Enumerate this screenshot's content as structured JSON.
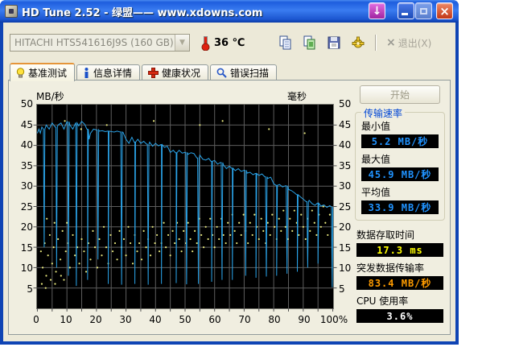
{
  "window": {
    "title": "HD Tune 2.52 - 绿盟—— www.xdowns.com"
  },
  "toolbar": {
    "drive_selected": "HITACHI HTS541616J9S (160 GB)",
    "temperature": "36 ℃",
    "exit_label": "退出(X)"
  },
  "tabs": [
    {
      "label": "基准测试",
      "icon": "lightbulb-icon",
      "active": true
    },
    {
      "label": "信息详情",
      "icon": "info-icon",
      "active": false
    },
    {
      "label": "健康状况",
      "icon": "health-cross-icon",
      "active": false
    },
    {
      "label": "错误扫描",
      "icon": "magnifier-icon",
      "active": false
    }
  ],
  "benchmark": {
    "start_label": "开始",
    "stats": {
      "group_title": "传输速率",
      "min": {
        "label": "最小值",
        "value": "5.2 MB/秒",
        "value_color": "#2093ff"
      },
      "max": {
        "label": "最大值",
        "value": "45.9 MB/秒",
        "value_color": "#2093ff"
      },
      "avg": {
        "label": "平均值",
        "value": "33.9 MB/秒",
        "value_color": "#2093ff"
      },
      "access": {
        "label": "数据存取时间",
        "value": "17.3 ms",
        "value_color": "#ffff00"
      },
      "burst": {
        "label": "突发数据传输率",
        "value": "83.4 MB/秒",
        "value_color": "#ff9c00"
      },
      "cpu": {
        "label": "CPU 使用率",
        "value": "3.6%",
        "value_color": "#ffffff"
      }
    }
  },
  "chart_data": {
    "type": "line+scatter",
    "background": "#000000",
    "grid_color": "#5e5e5e",
    "grid": true,
    "left_axis": {
      "label": "MB/秒",
      "min": 0,
      "max": 50,
      "tick_step": 5
    },
    "right_axis": {
      "label": "毫秒",
      "min": 0,
      "max": 50,
      "tick_step": 5
    },
    "x_axis": {
      "min": 0,
      "max": 100,
      "grid_step": 5,
      "labels": [
        "0",
        "10",
        "20",
        "30",
        "40",
        "50",
        "60",
        "70",
        "80",
        "90",
        "100%"
      ]
    },
    "series": [
      {
        "name": "传输速率",
        "type": "line",
        "color": "#2aa3e8",
        "base_points": [
          [
            0,
            43
          ],
          [
            0.5,
            44
          ],
          [
            1,
            43
          ],
          [
            1.5,
            44.5
          ],
          [
            2,
            44
          ],
          [
            3,
            45
          ],
          [
            4,
            44
          ],
          [
            5,
            45.5
          ],
          [
            6,
            44.5
          ],
          [
            7,
            45
          ],
          [
            8,
            45.5
          ],
          [
            9,
            44
          ],
          [
            10,
            45.8
          ],
          [
            11,
            45
          ],
          [
            12,
            44
          ],
          [
            13,
            45.5
          ],
          [
            14,
            44.8
          ],
          [
            15,
            45.9
          ],
          [
            16,
            45.2
          ],
          [
            17,
            44
          ],
          [
            17.5,
            41.5
          ],
          [
            18,
            43
          ],
          [
            19,
            44
          ],
          [
            20,
            43.8
          ],
          [
            21,
            43.5
          ],
          [
            22,
            43.6
          ],
          [
            23,
            43.4
          ],
          [
            24,
            43.5
          ],
          [
            25,
            43.4
          ],
          [
            26,
            43.3
          ],
          [
            27,
            43.5
          ],
          [
            28,
            43.3
          ],
          [
            29,
            43.2
          ],
          [
            30,
            41.5
          ],
          [
            31,
            40.5
          ],
          [
            32,
            42
          ],
          [
            33,
            40.8
          ],
          [
            34,
            41.5
          ],
          [
            35,
            40.5
          ],
          [
            36,
            41
          ],
          [
            37,
            40.3
          ],
          [
            38,
            40.8
          ],
          [
            39,
            39.8
          ],
          [
            40,
            40.5
          ],
          [
            41,
            39.9
          ],
          [
            42,
            40.2
          ],
          [
            43,
            39.5
          ],
          [
            44,
            39.8
          ],
          [
            45,
            38.3
          ],
          [
            46,
            38.8
          ],
          [
            47,
            38.2
          ],
          [
            48,
            38.8
          ],
          [
            49,
            38.1
          ],
          [
            50,
            38.3
          ],
          [
            51,
            37.8
          ],
          [
            52,
            38.2
          ],
          [
            53,
            38
          ],
          [
            54,
            36.9
          ],
          [
            55,
            37.6
          ],
          [
            56,
            36.6
          ],
          [
            57,
            36.4
          ],
          [
            58,
            36.8
          ],
          [
            59,
            36.1
          ],
          [
            60,
            36.3
          ],
          [
            61,
            35.4
          ],
          [
            62,
            35.8
          ],
          [
            63,
            35.2
          ],
          [
            64,
            34.3
          ],
          [
            65,
            34.9
          ],
          [
            66,
            34.4
          ],
          [
            67,
            33.8
          ],
          [
            68,
            34.3
          ],
          [
            69,
            33.6
          ],
          [
            70,
            33.9
          ],
          [
            71,
            33.2
          ],
          [
            72,
            33.4
          ],
          [
            73,
            32.8
          ],
          [
            74,
            33.1
          ],
          [
            75,
            32.6
          ],
          [
            76,
            33
          ],
          [
            77,
            32.3
          ],
          [
            78,
            31.9
          ],
          [
            79,
            32.2
          ],
          [
            80,
            30.6
          ],
          [
            81,
            30.2
          ],
          [
            82,
            30.4
          ],
          [
            83,
            29.8
          ],
          [
            84,
            30.1
          ],
          [
            85,
            29.2
          ],
          [
            86,
            28.9
          ],
          [
            87,
            28.4
          ],
          [
            88,
            27.9
          ],
          [
            89,
            27.4
          ],
          [
            90,
            26.8
          ],
          [
            91,
            26.2
          ],
          [
            92,
            26.5
          ],
          [
            93,
            25.7
          ],
          [
            94,
            25.3
          ],
          [
            95,
            25.8
          ],
          [
            96,
            25.1
          ],
          [
            97,
            25.4
          ],
          [
            98,
            24.8
          ],
          [
            99,
            25.2
          ],
          [
            100,
            24.9
          ]
        ],
        "spikes": [
          {
            "x": 2.3,
            "y": 15
          },
          {
            "x": 6.5,
            "y": 10
          },
          {
            "x": 10.5,
            "y": 8
          },
          {
            "x": 13.2,
            "y": 5.5
          },
          {
            "x": 17,
            "y": 7
          },
          {
            "x": 20.5,
            "y": 12
          },
          {
            "x": 24,
            "y": 6
          },
          {
            "x": 28.5,
            "y": 5.8
          },
          {
            "x": 33,
            "y": 6
          },
          {
            "x": 37.5,
            "y": 5.8
          },
          {
            "x": 42,
            "y": 6
          },
          {
            "x": 47,
            "y": 6.2
          },
          {
            "x": 50.5,
            "y": 5.9
          },
          {
            "x": 54.5,
            "y": 6
          },
          {
            "x": 59,
            "y": 6.5
          },
          {
            "x": 62.5,
            "y": 7
          },
          {
            "x": 66,
            "y": 7
          },
          {
            "x": 70.5,
            "y": 8
          },
          {
            "x": 74,
            "y": 7.5
          },
          {
            "x": 77.5,
            "y": 7.8
          },
          {
            "x": 81,
            "y": 8
          },
          {
            "x": 84.5,
            "y": 8.5
          },
          {
            "x": 88,
            "y": 9
          },
          {
            "x": 91.5,
            "y": 10
          },
          {
            "x": 95,
            "y": 11
          },
          {
            "x": 99.8,
            "y": 5.2
          }
        ],
        "stats": {
          "min": 5.2,
          "max": 45.9,
          "avg": 33.9
        }
      },
      {
        "name": "存取时间",
        "type": "scatter",
        "color": "#e9e97e",
        "points": [
          [
            1.2,
            14
          ],
          [
            1.5,
            6
          ],
          [
            1.8,
            10
          ],
          [
            2.5,
            16
          ],
          [
            2.8,
            5
          ],
          [
            3,
            8
          ],
          [
            3.2,
            22
          ],
          [
            3.6,
            13
          ],
          [
            4.2,
            18
          ],
          [
            4.5,
            7
          ],
          [
            5,
            11
          ],
          [
            5.5,
            15
          ],
          [
            5.8,
            21
          ],
          [
            6,
            6
          ],
          [
            6.3,
            9
          ],
          [
            7,
            17
          ],
          [
            7.8,
            12
          ],
          [
            8,
            8
          ],
          [
            8.5,
            19
          ],
          [
            9,
            7
          ],
          [
            9.3,
            46
          ],
          [
            9.6,
            14
          ],
          [
            10,
            21
          ],
          [
            10.4,
            16
          ],
          [
            11,
            10
          ],
          [
            12,
            18
          ],
          [
            12.7,
            13
          ],
          [
            13.5,
            15
          ],
          [
            14.2,
            11
          ],
          [
            14.8,
            44
          ],
          [
            15,
            17
          ],
          [
            15.8,
            14
          ],
          [
            16.5,
            9
          ],
          [
            17.3,
            16
          ],
          [
            18,
            12
          ],
          [
            18.8,
            19
          ],
          [
            19.5,
            15
          ],
          [
            20.3,
            10
          ],
          [
            21,
            17
          ],
          [
            21.8,
            13
          ],
          [
            22.5,
            20
          ],
          [
            23.3,
            15
          ],
          [
            23.5,
            45
          ],
          [
            24,
            11
          ],
          [
            24.8,
            18
          ],
          [
            25.5,
            14
          ],
          [
            26.3,
            16
          ],
          [
            27,
            12
          ],
          [
            27.8,
            19
          ],
          [
            28.5,
            15
          ],
          [
            29.3,
            17
          ],
          [
            30,
            13
          ],
          [
            30.8,
            20
          ],
          [
            31.5,
            16
          ],
          [
            32.3,
            11
          ],
          [
            33,
            18
          ],
          [
            33.8,
            14
          ],
          [
            34.5,
            16
          ],
          [
            35.3,
            12
          ],
          [
            36,
            19
          ],
          [
            36.8,
            15
          ],
          [
            37.5,
            17
          ],
          [
            38.3,
            13
          ],
          [
            39,
            20
          ],
          [
            39.4,
            46
          ],
          [
            39.8,
            16
          ],
          [
            40.5,
            18
          ],
          [
            41.3,
            14
          ],
          [
            42,
            16
          ],
          [
            42.8,
            21
          ],
          [
            43.5,
            15
          ],
          [
            44.3,
            18
          ],
          [
            45,
            13
          ],
          [
            45.8,
            19
          ],
          [
            46.5,
            16
          ],
          [
            47.3,
            21
          ],
          [
            48,
            17
          ],
          [
            48.8,
            14
          ],
          [
            49.5,
            19
          ],
          [
            50.3,
            16
          ],
          [
            51,
            21
          ],
          [
            51.8,
            17
          ],
          [
            52.5,
            14
          ],
          [
            53.3,
            19
          ],
          [
            54,
            16
          ],
          [
            54.8,
            22
          ],
          [
            55,
            45
          ],
          [
            55.5,
            18
          ],
          [
            56.3,
            15
          ],
          [
            57,
            20
          ],
          [
            57.8,
            17
          ],
          [
            58.5,
            22
          ],
          [
            59.3,
            18
          ],
          [
            60,
            15
          ],
          [
            60.8,
            20
          ],
          [
            61.5,
            17
          ],
          [
            62.3,
            22
          ],
          [
            62.7,
            46
          ],
          [
            63,
            18
          ],
          [
            63.8,
            16
          ],
          [
            64.5,
            21
          ],
          [
            65.3,
            18
          ],
          [
            66,
            23
          ],
          [
            66.8,
            19
          ],
          [
            67.5,
            16
          ],
          [
            68.3,
            21
          ],
          [
            69,
            18
          ],
          [
            69.8,
            23
          ],
          [
            70.5,
            19
          ],
          [
            71.3,
            16
          ],
          [
            72,
            21
          ],
          [
            72.8,
            18
          ],
          [
            73.5,
            23
          ],
          [
            74.3,
            20
          ],
          [
            75,
            17
          ],
          [
            75.8,
            22
          ],
          [
            76.5,
            19
          ],
          [
            77.3,
            16
          ],
          [
            78,
            21
          ],
          [
            78.4,
            44
          ],
          [
            78.8,
            18
          ],
          [
            79.5,
            23
          ],
          [
            80.3,
            20
          ],
          [
            81,
            17
          ],
          [
            81.8,
            22
          ],
          [
            82.5,
            19
          ],
          [
            83.3,
            24
          ],
          [
            84,
            20
          ],
          [
            84.8,
            17
          ],
          [
            85.5,
            22
          ],
          [
            86.3,
            19
          ],
          [
            87,
            24
          ],
          [
            87.8,
            21
          ],
          [
            88.5,
            18
          ],
          [
            89.3,
            23
          ],
          [
            90,
            20
          ],
          [
            90.5,
            43
          ],
          [
            90.8,
            17
          ],
          [
            91.5,
            22
          ],
          [
            92.3,
            19
          ],
          [
            93,
            24
          ],
          [
            93.8,
            21
          ],
          [
            94.5,
            18
          ],
          [
            95.3,
            23
          ],
          [
            96,
            20
          ],
          [
            96.8,
            25
          ],
          [
            97.5,
            21
          ],
          [
            98.3,
            18
          ],
          [
            99,
            23
          ]
        ],
        "access_time_ms": 17.3
      }
    ]
  }
}
